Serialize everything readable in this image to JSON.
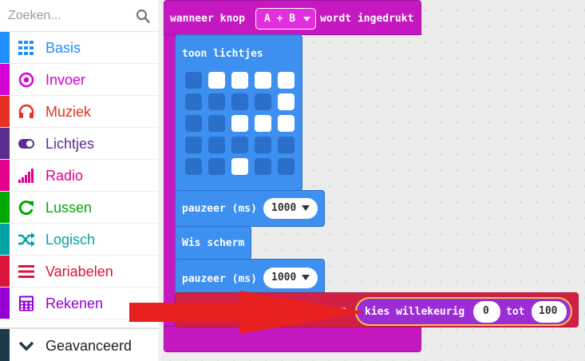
{
  "search": {
    "placeholder": "Zoeken..."
  },
  "categories": [
    {
      "label": "Basis",
      "color": "#1e90ff",
      "icon": "grid-icon"
    },
    {
      "label": "Invoer",
      "color": "#d400d4",
      "icon": "target-icon"
    },
    {
      "label": "Muziek",
      "color": "#e63022",
      "icon": "headphones-icon"
    },
    {
      "label": "Lichtjes",
      "color": "#5c2d91",
      "icon": "toggle-icon"
    },
    {
      "label": "Radio",
      "color": "#e3008c",
      "icon": "signal-icon"
    },
    {
      "label": "Lussen",
      "color": "#00aa00",
      "icon": "refresh-icon"
    },
    {
      "label": "Logisch",
      "color": "#00a4a6",
      "icon": "shuffle-icon"
    },
    {
      "label": "Variabelen",
      "color": "#dc143c",
      "icon": "list-icon"
    },
    {
      "label": "Rekenen",
      "color": "#9400d3",
      "icon": "calculator-icon"
    }
  ],
  "advanced": {
    "label": "Geavanceerd",
    "icon": "chevron-down-icon"
  },
  "blocks": {
    "event": {
      "text_before": "wanneer knop",
      "button": "A + B",
      "text_after": "wordt ingedrukt"
    },
    "show_leds": {
      "label": "toon lichtjes"
    },
    "leds": [
      [
        0,
        1,
        1,
        1,
        1
      ],
      [
        0,
        0,
        0,
        0,
        1
      ],
      [
        0,
        0,
        1,
        1,
        1
      ],
      [
        0,
        0,
        0,
        0,
        0
      ],
      [
        0,
        0,
        1,
        0,
        0
      ]
    ],
    "pause1": {
      "label": "pauzeer (ms)",
      "value": "1000"
    },
    "clear": {
      "label": "Wis scherm"
    },
    "pause2": {
      "label": "pauzeer (ms)",
      "value": "1000"
    },
    "set_var": {
      "trailing": "p"
    },
    "random": {
      "label": "kies willekeurig",
      "from": "0",
      "to_label": "tot",
      "to": "100"
    }
  },
  "colors": {
    "led_on": "#ffffff",
    "led_off": "#2a6fc9",
    "event": "#c518c0",
    "basic": "#3d8ff0",
    "variables": "#d22045",
    "math": "#9c2dd6",
    "highlight": "#f1c644",
    "arrow": "#e82020"
  }
}
